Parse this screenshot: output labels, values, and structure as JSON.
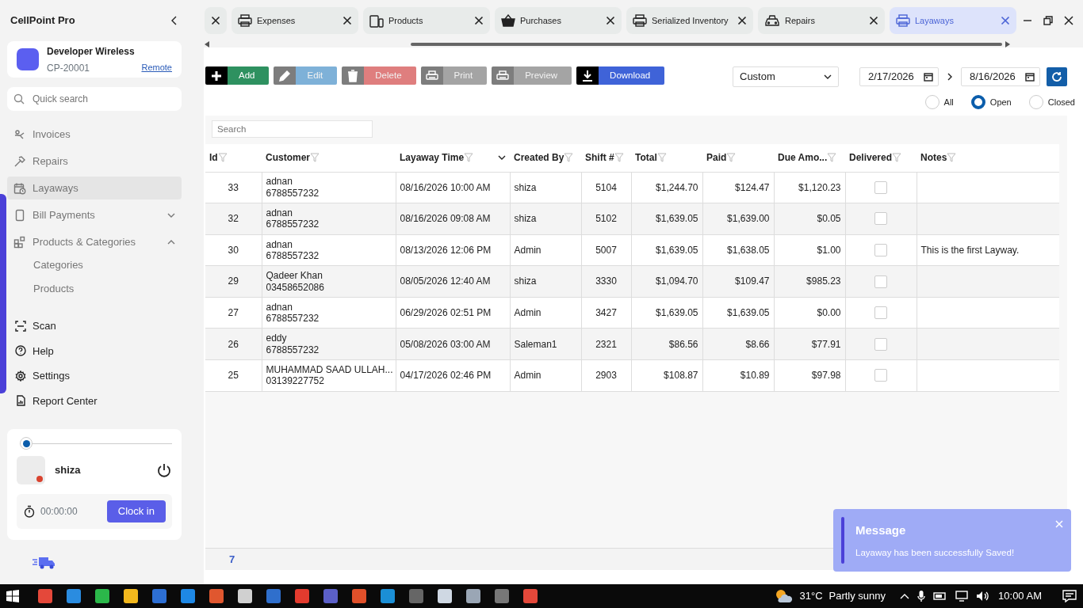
{
  "app": {
    "title": "CellPoint Pro"
  },
  "store": {
    "name": "Developer Wireless",
    "code": "CP-20001",
    "link": "Remote"
  },
  "quick_search": {
    "placeholder": "Quick search"
  },
  "sidebar": {
    "items": [
      {
        "label": "Invoices",
        "selected": false
      },
      {
        "label": "Repairs",
        "selected": false
      },
      {
        "label": "Layaways",
        "selected": true
      },
      {
        "label": "Bill Payments",
        "selected": false,
        "expanded": false
      },
      {
        "label": "Products & Categories",
        "selected": false,
        "expanded": true,
        "children": [
          {
            "label": "Categories"
          },
          {
            "label": "Products"
          }
        ]
      }
    ],
    "tools": [
      {
        "label": "Scan"
      },
      {
        "label": "Help"
      },
      {
        "label": "Settings"
      },
      {
        "label": "Report Center"
      }
    ]
  },
  "user": {
    "name": "shiza",
    "clocked_in": false,
    "switch_on": false,
    "timer": "00:00:00",
    "button": "Clock in"
  },
  "tabs": [
    {
      "kind": "cut",
      "selected": false
    },
    {
      "kind": "full",
      "label": "Expenses",
      "selected": false
    },
    {
      "kind": "full",
      "label": "Products",
      "selected": false
    },
    {
      "kind": "full",
      "label": "Purchases",
      "selected": false
    },
    {
      "kind": "full",
      "label": "Serialized Inventory",
      "selected": false
    },
    {
      "kind": "full",
      "label": "Repairs",
      "selected": false
    },
    {
      "kind": "full",
      "label": "Layaways",
      "selected": true
    }
  ],
  "toolbar": [
    {
      "label": "Add",
      "disabled": false,
      "color": "#2e9160"
    },
    {
      "label": "Edit",
      "disabled": true,
      "color": "#7eb1d8"
    },
    {
      "label": "Delete",
      "disabled": true,
      "color": "#df7e7e"
    },
    {
      "label": "Print",
      "disabled": true,
      "color": "#a4a4a4"
    },
    {
      "label": "Preview",
      "disabled": true,
      "color": "#a4a4a4"
    },
    {
      "label": "Download",
      "disabled": false,
      "color": "#3f63d8"
    }
  ],
  "filter": {
    "range": "Custom",
    "from": "2/17/2026",
    "to": "8/16/2026",
    "status": [
      {
        "label": "All",
        "selected": false
      },
      {
        "label": "Open",
        "selected": true
      },
      {
        "label": "Closed",
        "selected": false
      }
    ]
  },
  "table": {
    "search_placeholder": "Search",
    "columns": [
      {
        "label": "Id",
        "sorted": false
      },
      {
        "label": "Customer",
        "sorted": false
      },
      {
        "label": "Layaway Time",
        "sorted": true
      },
      {
        "label": "Created By",
        "sorted": false
      },
      {
        "label": "Shift #",
        "sorted": false
      },
      {
        "label": "Total",
        "sorted": false
      },
      {
        "label": "Paid",
        "sorted": false
      },
      {
        "label": "Due Amo...",
        "sorted": false
      },
      {
        "label": "Delivered",
        "sorted": false
      },
      {
        "label": "Notes",
        "sorted": false
      }
    ],
    "rows": [
      {
        "id": "33",
        "customer": "adnan",
        "phone": "6788557232",
        "time": "08/16/2026 10:00 AM",
        "created_by": "shiza",
        "shift": "5104",
        "total": "$1,244.70",
        "paid": "$124.47",
        "due": "$1,120.23",
        "delivered": false
      },
      {
        "id": "32",
        "customer": "adnan",
        "phone": "6788557232",
        "time": "08/16/2026 09:08 AM",
        "created_by": "shiza",
        "shift": "5102",
        "total": "$1,639.05",
        "paid": "$1,639.00",
        "due": "$0.05",
        "delivered": false
      },
      {
        "id": "30",
        "customer": "adnan",
        "phone": "6788557232",
        "time": "08/13/2026 12:06 PM",
        "created_by": "Admin",
        "shift": "5007",
        "total": "$1,639.05",
        "paid": "$1,638.05",
        "due": "$1.00",
        "delivered": false,
        "notes": "This is the first Layway."
      },
      {
        "id": "29",
        "customer": "Qadeer Khan",
        "phone": "03458652086",
        "time": "08/05/2026 12:40 AM",
        "created_by": "shiza",
        "shift": "3330",
        "total": "$1,094.70",
        "paid": "$109.47",
        "due": "$985.23",
        "delivered": false
      },
      {
        "id": "27",
        "customer": "adnan",
        "phone": "6788557232",
        "time": "06/29/2026 02:51 PM",
        "created_by": "Admin",
        "shift": "3427",
        "total": "$1,639.05",
        "paid": "$1,639.05",
        "due": "$0.00",
        "delivered": false
      },
      {
        "id": "26",
        "customer": "eddy",
        "phone": "6788557232",
        "time": "05/08/2026 03:00 AM",
        "created_by": "Saleman1",
        "shift": "2321",
        "total": "$86.56",
        "paid": "$8.66",
        "due": "$77.91",
        "delivered": false
      },
      {
        "id": "25",
        "customer": "MUHAMMAD SAAD ULLAH...",
        "phone": "03139227752",
        "time": "04/17/2026 02:46 PM",
        "created_by": "Admin",
        "shift": "2903",
        "total": "$108.87",
        "paid": "$10.89",
        "due": "$97.98",
        "delivered": false
      }
    ],
    "count": "7"
  },
  "toast": {
    "title": "Message",
    "text": "Layaway has been successfully Saved!"
  },
  "taskbar": {
    "weather": "31°C",
    "forecast": "Partly sunny",
    "time": "10:00 AM"
  }
}
